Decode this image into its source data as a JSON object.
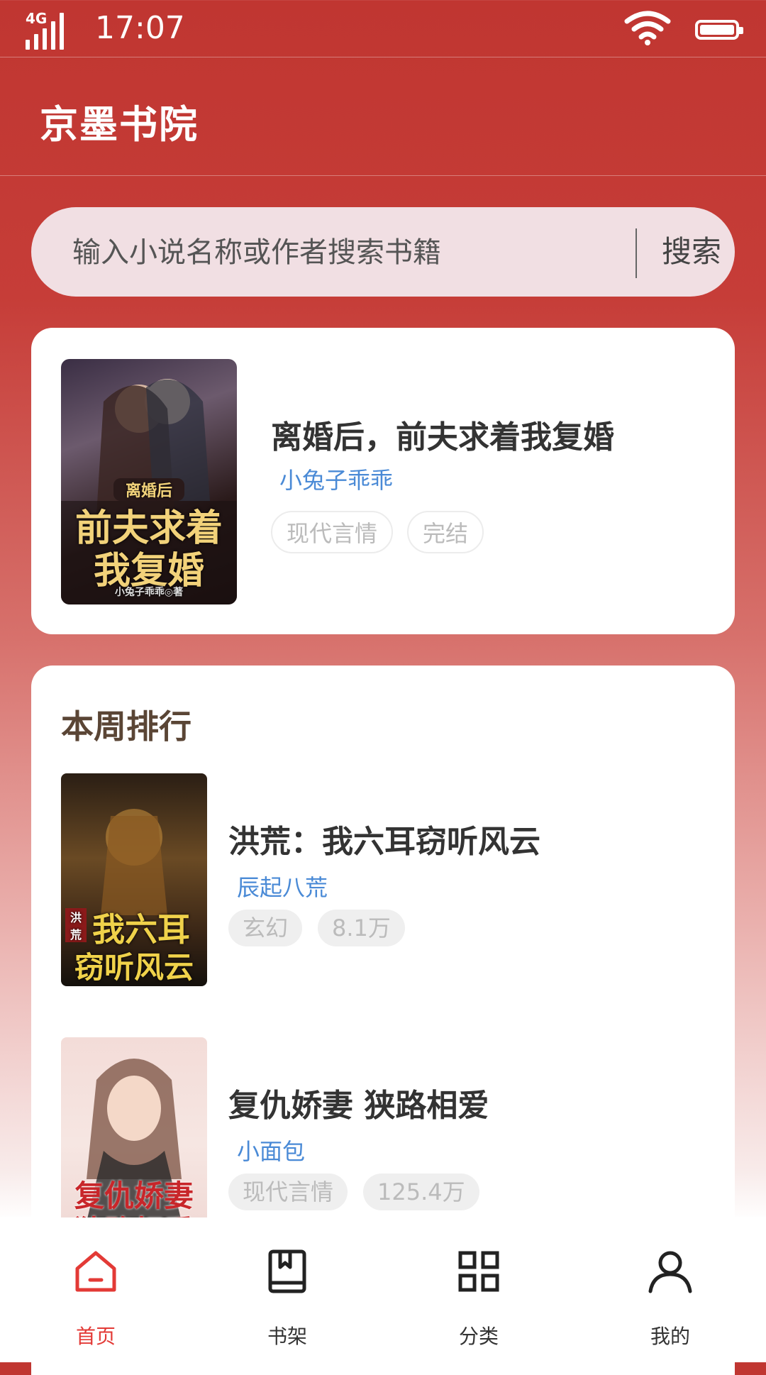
{
  "status_bar": {
    "network": "4G",
    "time": "17:07"
  },
  "app": {
    "title": "京墨书院"
  },
  "search": {
    "placeholder": "输入小说名称或作者搜索书籍",
    "button_label": "搜索"
  },
  "featured": {
    "title": "离婚后，前夫求着我复婚",
    "author": "小兔子乖乖",
    "tags": [
      "现代言情",
      "完结"
    ],
    "cover_text": {
      "small": "离婚后",
      "line1": "前夫求着",
      "line2": "我复婚",
      "credit": "小兔子乖乖◎著"
    }
  },
  "ranking": {
    "title": "本周排行",
    "items": [
      {
        "name": "洪荒：我六耳窃听风云",
        "author": "辰起八荒",
        "tags": [
          "玄幻",
          "8.1万"
        ],
        "cover_text": {
          "line1": "我六耳",
          "line2": "窃听风云",
          "side": "洪荒"
        }
      },
      {
        "name": "复仇娇妻 狭路相爱",
        "author": "小面包",
        "tags": [
          "现代言情",
          "125.4万"
        ],
        "cover_text": {
          "line1": "复仇娇妻",
          "line2": "狭路相爱"
        }
      }
    ]
  },
  "tabbar": {
    "items": [
      {
        "label": "首页",
        "icon": "home-icon",
        "active": true
      },
      {
        "label": "书架",
        "icon": "bookshelf-icon",
        "active": false
      },
      {
        "label": "分类",
        "icon": "grid-icon",
        "active": false
      },
      {
        "label": "我的",
        "icon": "user-icon",
        "active": false
      }
    ]
  },
  "colors": {
    "accent": "#e33a36",
    "header_red": "#c03631",
    "author_blue": "#4a8ad6"
  }
}
